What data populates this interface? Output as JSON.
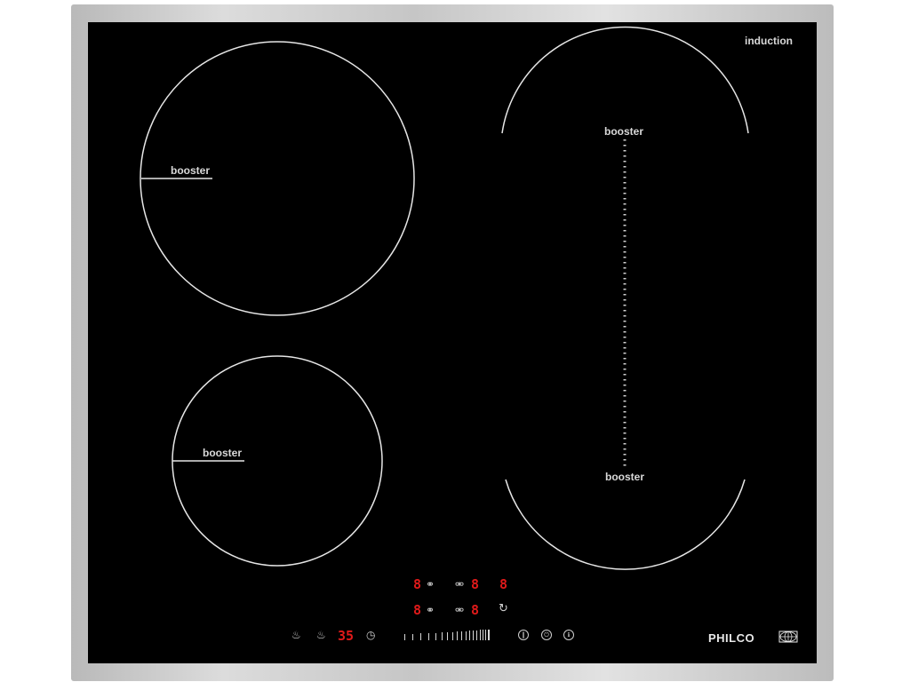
{
  "hob": {
    "type_label": "induction",
    "brand": "PHILCO",
    "zones": [
      {
        "id": "rear-left",
        "booster_label": "booster"
      },
      {
        "id": "front-left",
        "booster_label": "booster"
      },
      {
        "id": "right-flex-top",
        "booster_label": "booster"
      },
      {
        "id": "right-flex-bottom",
        "booster_label": "booster"
      }
    ],
    "displays": {
      "row1": [
        "8",
        "8",
        "8"
      ],
      "row2": [
        "8",
        "8"
      ],
      "timer": "35"
    },
    "icons": {
      "keep-warm": "keep-warm-icon",
      "pot": "pot-icon",
      "timer": "clock-icon",
      "pause": "pause-icon",
      "power": "power-icon",
      "lock": "lock-icon",
      "flex": "flex-zone-icon",
      "bridge": "bridge-icon",
      "brand-logo": "globe-logo-icon"
    },
    "colors": {
      "glass": "#000000",
      "frame": "#c8c8c8",
      "display_red": "#e01a1a",
      "print": "#d9d9d9"
    }
  }
}
